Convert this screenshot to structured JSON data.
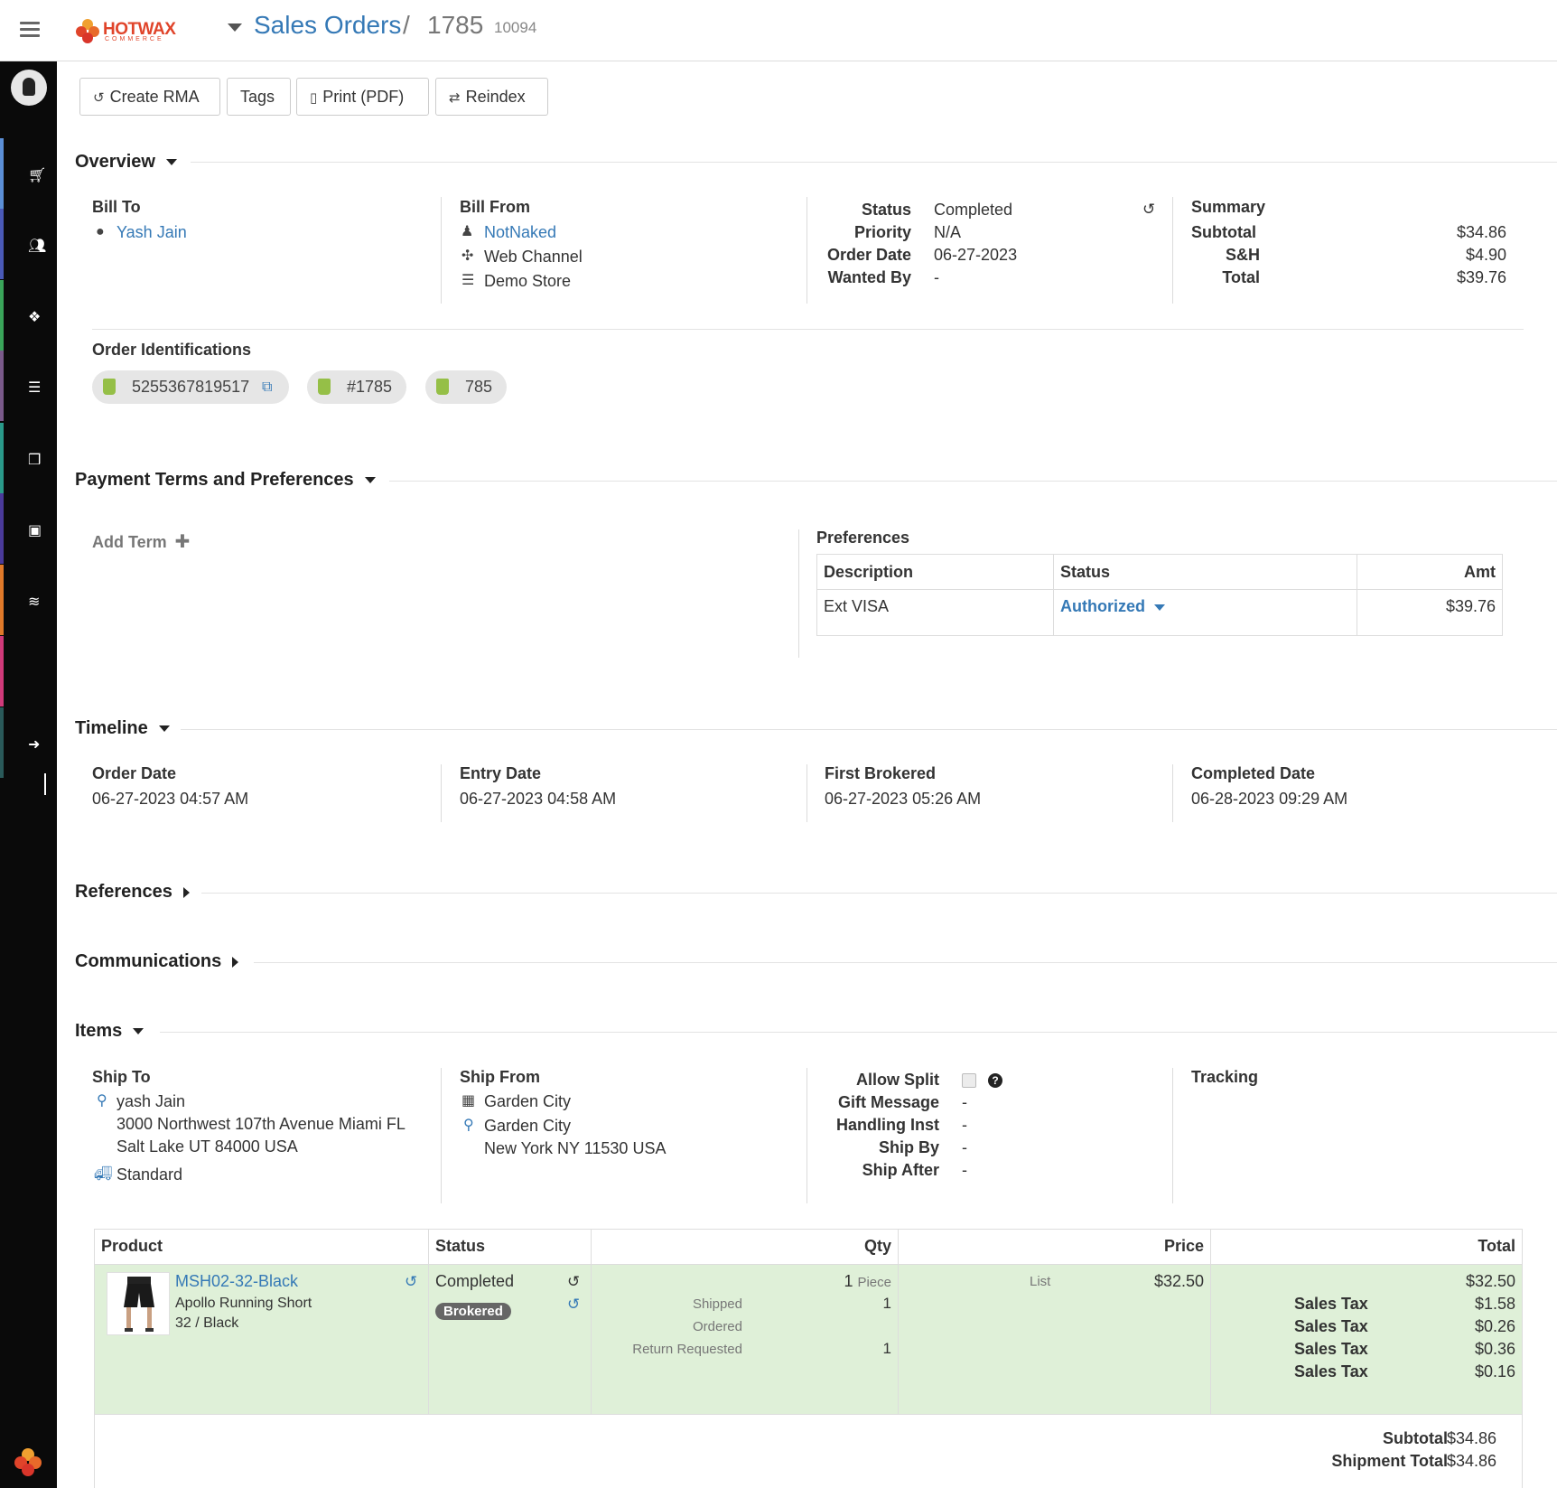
{
  "header": {
    "brand": "HOTWAX",
    "brand_sub": "COMMERCE",
    "breadcrumb_link": "Sales Orders",
    "breadcrumb_sep": "/",
    "order_id": "1785",
    "order_sub_id": "10094"
  },
  "toolbar": {
    "create_rma": "Create RMA",
    "tags": "Tags",
    "print_pdf": "Print (PDF)",
    "reindex": "Reindex"
  },
  "overview": {
    "title": "Overview",
    "bill_to_label": "Bill To",
    "bill_to_name": "Yash Jain",
    "bill_from_label": "Bill From",
    "bill_from_name": "NotNaked",
    "bill_from_channel": "Web Channel",
    "bill_from_store": "Demo Store",
    "status_label": "Status",
    "status_value": "Completed",
    "priority_label": "Priority",
    "priority_value": "N/A",
    "order_date_label": "Order Date",
    "order_date_value": "06-27-2023",
    "wanted_by_label": "Wanted By",
    "wanted_by_value": "-",
    "summary_label": "Summary",
    "subtotal_label": "Subtotal",
    "subtotal_value": "$34.86",
    "sh_label": "S&H",
    "sh_value": "$4.90",
    "total_label": "Total",
    "total_value": "$39.76",
    "identifications_label": "Order Identifications",
    "identifications": [
      "5255367819517",
      "#1785",
      "785"
    ]
  },
  "payment": {
    "title": "Payment Terms and Preferences",
    "add_term": "Add Term",
    "preferences_label": "Preferences",
    "columns": [
      "Description",
      "Status",
      "Amt"
    ],
    "row": {
      "description": "Ext VISA",
      "status": "Authorized",
      "amount": "$39.76"
    }
  },
  "timeline": {
    "title": "Timeline",
    "order_date_label": "Order Date",
    "order_date": "06-27-2023 04:57 AM",
    "entry_date_label": "Entry Date",
    "entry_date": "06-27-2023 04:58 AM",
    "first_brokered_label": "First Brokered",
    "first_brokered": "06-27-2023 05:26 AM",
    "completed_date_label": "Completed Date",
    "completed_date": "06-28-2023 09:29 AM"
  },
  "references": {
    "title": "References"
  },
  "communications": {
    "title": "Communications"
  },
  "items": {
    "title": "Items",
    "ship_to_label": "Ship To",
    "ship_to_name": "yash Jain",
    "ship_to_addr1": "3000 Northwest 107th Avenue Miami FL",
    "ship_to_addr2": "Salt Lake UT 84000 USA",
    "ship_method": "Standard",
    "ship_from_label": "Ship From",
    "ship_from_facility": "Garden City",
    "ship_from_city": "Garden City",
    "ship_from_addr": "New York NY 11530 USA",
    "allow_split_label": "Allow Split",
    "gift_message_label": "Gift Message",
    "gift_message_value": "-",
    "handling_inst_label": "Handling Inst",
    "handling_inst_value": "-",
    "ship_by_label": "Ship By",
    "ship_by_value": "-",
    "ship_after_label": "Ship After",
    "ship_after_value": "-",
    "tracking_label": "Tracking",
    "columns": [
      "Product",
      "Status",
      "Qty",
      "Price",
      "Total"
    ],
    "line": {
      "sku": "MSH02-32-Black",
      "name": "Apollo Running Short",
      "variant": "32 / Black",
      "status": "Completed",
      "badge": "Brokered",
      "qty": "1",
      "qty_unit": "Piece",
      "shipped_label": "Shipped",
      "shipped_qty": "1",
      "ordered_label": "Ordered",
      "return_label": "Return Requested",
      "return_qty": "1",
      "price_label": "List",
      "price": "$32.50",
      "total": "$32.50",
      "taxes": [
        {
          "label": "Sales Tax",
          "amount": "$1.58"
        },
        {
          "label": "Sales Tax",
          "amount": "$0.26"
        },
        {
          "label": "Sales Tax",
          "amount": "$0.36"
        },
        {
          "label": "Sales Tax",
          "amount": "$0.16"
        }
      ]
    },
    "footer": {
      "subtotal_label": "Subtotal",
      "subtotal_value": "$34.86",
      "shipment_total_label": "Shipment Total",
      "shipment_total_value": "$34.86"
    }
  },
  "colors": {
    "link": "#3579b6",
    "brand": "#e0442a",
    "row_highlight": "#dff0d8",
    "sidebar": "#0a0a0a"
  },
  "icons": [
    "menu-icon",
    "user-icon",
    "cart-icon",
    "users-icon",
    "cubes-icon",
    "server-icon",
    "dropbox-icon",
    "money-icon",
    "database-icon",
    "sign-out-icon",
    "history-icon",
    "external-link-icon",
    "truck-icon",
    "map-marker-icon",
    "building-icon",
    "question-icon"
  ]
}
